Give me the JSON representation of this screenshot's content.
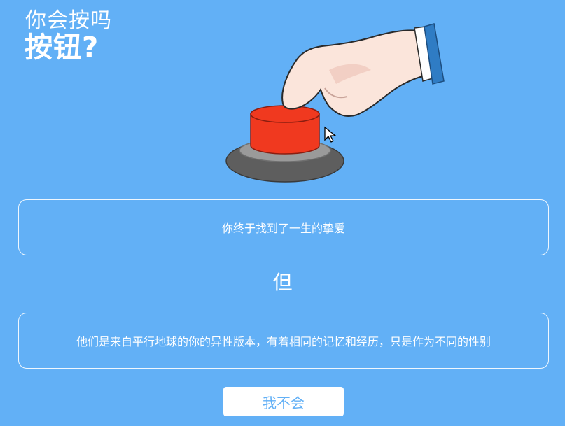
{
  "header": {
    "subtitle": "你会按吗",
    "title": "按钮?"
  },
  "dilemma": {
    "benefit": "你终于找到了一生的挚爱",
    "connector": "但",
    "drawback": "他们是来自平行地球的你的异性版本，有着相同的记忆和经历，只是作为不同的性别"
  },
  "actions": {
    "decline_label": "我不会"
  },
  "colors": {
    "background": "#62b0f6",
    "button_red": "#f0391f",
    "base_dark": "#5e5e5e",
    "cuff_blue": "#2f7cc4"
  },
  "icons": {
    "illustration": "hand-pressing-red-button",
    "cursor": "mouse-pointer-icon"
  }
}
